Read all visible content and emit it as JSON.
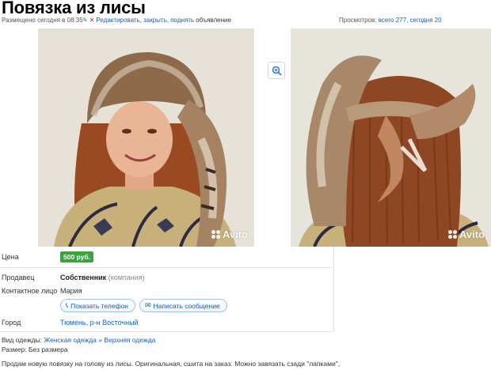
{
  "title": "Повязка из лисы",
  "meta": {
    "posted": "Размещено сегодня в 08:35",
    "edit_link": "Редактировать, закрыть, поднять",
    "edit_rest": "объявление",
    "views_label": "Просмотров:",
    "views_value": "всего 277, сегодня 20"
  },
  "gallery": {
    "watermark": "Avito"
  },
  "details": {
    "price_label": "Цена",
    "price_value": "500 руб.",
    "seller_label": "Продавец",
    "seller_name": "Собственник",
    "seller_kind": "(компания)",
    "contact_label": "Контактное лицо",
    "contact_value": "Мария",
    "phone_button": "Показать телефон",
    "message_button": "Написать сообщение",
    "city_label": "Город",
    "city_value": "Тюмень, р-н Восточный"
  },
  "bottom": {
    "category_label": "Вид одежды:",
    "category_value": "Женская одежда » Верхняя одежда",
    "size_label": "Размер:",
    "size_value": "Без размера",
    "description": "Продам новую повязку на голову из лисы. Оригинальная, сшита на заказ. Можно завязать сзади \"лапками\","
  },
  "colors": {
    "link": "#1a5fb4",
    "price_bg": "#3aa33c"
  }
}
